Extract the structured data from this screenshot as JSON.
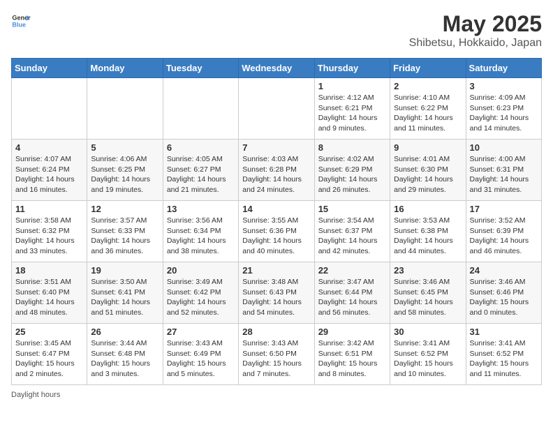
{
  "logo": {
    "line1": "General",
    "line2": "Blue"
  },
  "title": "May 2025",
  "location": "Shibetsu, Hokkaido, Japan",
  "footer": "Daylight hours",
  "headers": [
    "Sunday",
    "Monday",
    "Tuesday",
    "Wednesday",
    "Thursday",
    "Friday",
    "Saturday"
  ],
  "weeks": [
    [
      {
        "day": "",
        "info": ""
      },
      {
        "day": "",
        "info": ""
      },
      {
        "day": "",
        "info": ""
      },
      {
        "day": "",
        "info": ""
      },
      {
        "day": "1",
        "info": "Sunrise: 4:12 AM\nSunset: 6:21 PM\nDaylight: 14 hours\nand 9 minutes."
      },
      {
        "day": "2",
        "info": "Sunrise: 4:10 AM\nSunset: 6:22 PM\nDaylight: 14 hours\nand 11 minutes."
      },
      {
        "day": "3",
        "info": "Sunrise: 4:09 AM\nSunset: 6:23 PM\nDaylight: 14 hours\nand 14 minutes."
      }
    ],
    [
      {
        "day": "4",
        "info": "Sunrise: 4:07 AM\nSunset: 6:24 PM\nDaylight: 14 hours\nand 16 minutes."
      },
      {
        "day": "5",
        "info": "Sunrise: 4:06 AM\nSunset: 6:25 PM\nDaylight: 14 hours\nand 19 minutes."
      },
      {
        "day": "6",
        "info": "Sunrise: 4:05 AM\nSunset: 6:27 PM\nDaylight: 14 hours\nand 21 minutes."
      },
      {
        "day": "7",
        "info": "Sunrise: 4:03 AM\nSunset: 6:28 PM\nDaylight: 14 hours\nand 24 minutes."
      },
      {
        "day": "8",
        "info": "Sunrise: 4:02 AM\nSunset: 6:29 PM\nDaylight: 14 hours\nand 26 minutes."
      },
      {
        "day": "9",
        "info": "Sunrise: 4:01 AM\nSunset: 6:30 PM\nDaylight: 14 hours\nand 29 minutes."
      },
      {
        "day": "10",
        "info": "Sunrise: 4:00 AM\nSunset: 6:31 PM\nDaylight: 14 hours\nand 31 minutes."
      }
    ],
    [
      {
        "day": "11",
        "info": "Sunrise: 3:58 AM\nSunset: 6:32 PM\nDaylight: 14 hours\nand 33 minutes."
      },
      {
        "day": "12",
        "info": "Sunrise: 3:57 AM\nSunset: 6:33 PM\nDaylight: 14 hours\nand 36 minutes."
      },
      {
        "day": "13",
        "info": "Sunrise: 3:56 AM\nSunset: 6:34 PM\nDaylight: 14 hours\nand 38 minutes."
      },
      {
        "day": "14",
        "info": "Sunrise: 3:55 AM\nSunset: 6:36 PM\nDaylight: 14 hours\nand 40 minutes."
      },
      {
        "day": "15",
        "info": "Sunrise: 3:54 AM\nSunset: 6:37 PM\nDaylight: 14 hours\nand 42 minutes."
      },
      {
        "day": "16",
        "info": "Sunrise: 3:53 AM\nSunset: 6:38 PM\nDaylight: 14 hours\nand 44 minutes."
      },
      {
        "day": "17",
        "info": "Sunrise: 3:52 AM\nSunset: 6:39 PM\nDaylight: 14 hours\nand 46 minutes."
      }
    ],
    [
      {
        "day": "18",
        "info": "Sunrise: 3:51 AM\nSunset: 6:40 PM\nDaylight: 14 hours\nand 48 minutes."
      },
      {
        "day": "19",
        "info": "Sunrise: 3:50 AM\nSunset: 6:41 PM\nDaylight: 14 hours\nand 51 minutes."
      },
      {
        "day": "20",
        "info": "Sunrise: 3:49 AM\nSunset: 6:42 PM\nDaylight: 14 hours\nand 52 minutes."
      },
      {
        "day": "21",
        "info": "Sunrise: 3:48 AM\nSunset: 6:43 PM\nDaylight: 14 hours\nand 54 minutes."
      },
      {
        "day": "22",
        "info": "Sunrise: 3:47 AM\nSunset: 6:44 PM\nDaylight: 14 hours\nand 56 minutes."
      },
      {
        "day": "23",
        "info": "Sunrise: 3:46 AM\nSunset: 6:45 PM\nDaylight: 14 hours\nand 58 minutes."
      },
      {
        "day": "24",
        "info": "Sunrise: 3:46 AM\nSunset: 6:46 PM\nDaylight: 15 hours\nand 0 minutes."
      }
    ],
    [
      {
        "day": "25",
        "info": "Sunrise: 3:45 AM\nSunset: 6:47 PM\nDaylight: 15 hours\nand 2 minutes."
      },
      {
        "day": "26",
        "info": "Sunrise: 3:44 AM\nSunset: 6:48 PM\nDaylight: 15 hours\nand 3 minutes."
      },
      {
        "day": "27",
        "info": "Sunrise: 3:43 AM\nSunset: 6:49 PM\nDaylight: 15 hours\nand 5 minutes."
      },
      {
        "day": "28",
        "info": "Sunrise: 3:43 AM\nSunset: 6:50 PM\nDaylight: 15 hours\nand 7 minutes."
      },
      {
        "day": "29",
        "info": "Sunrise: 3:42 AM\nSunset: 6:51 PM\nDaylight: 15 hours\nand 8 minutes."
      },
      {
        "day": "30",
        "info": "Sunrise: 3:41 AM\nSunset: 6:52 PM\nDaylight: 15 hours\nand 10 minutes."
      },
      {
        "day": "31",
        "info": "Sunrise: 3:41 AM\nSunset: 6:52 PM\nDaylight: 15 hours\nand 11 minutes."
      }
    ]
  ]
}
